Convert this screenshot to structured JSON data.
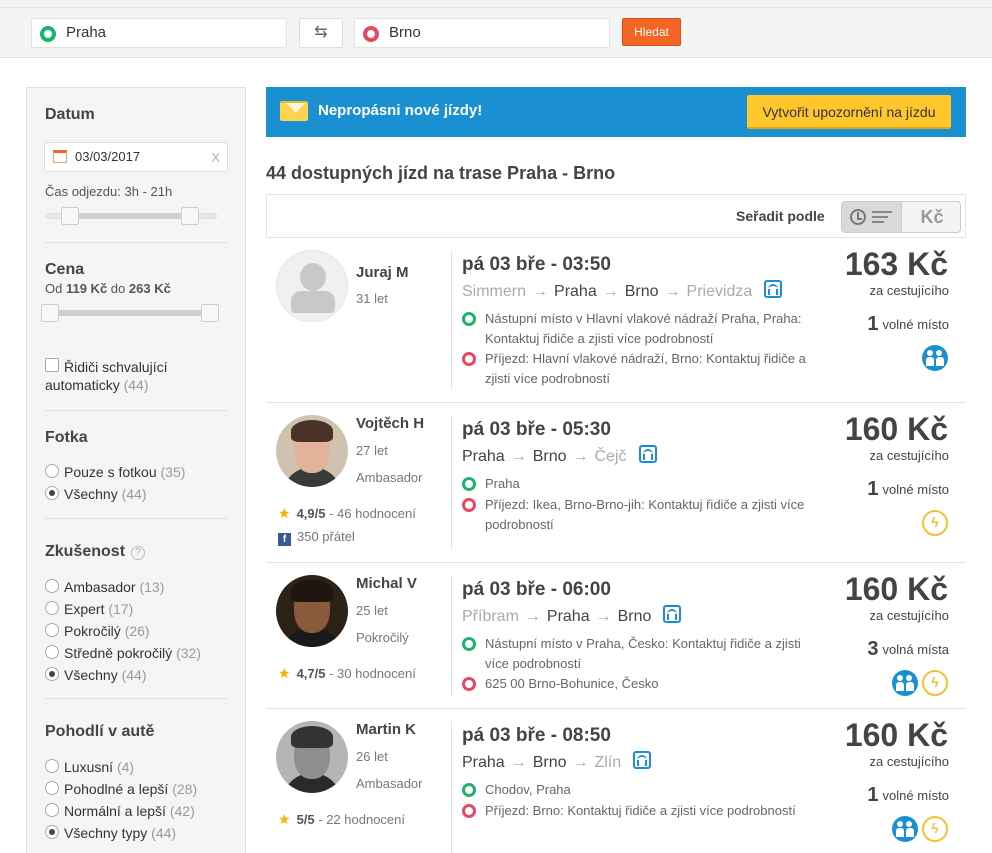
{
  "search": {
    "from": "Praha",
    "to": "Brno",
    "submit": "Hledat"
  },
  "sidebar": {
    "date_heading": "Datum",
    "date_value": "03/03/2017",
    "date_clear": "x",
    "departure_time": "Čas odjezdu: 3h - 21h",
    "departure_range": {
      "from_hour": 3,
      "to_hour": 21
    },
    "price_heading": "Cena",
    "price_from_label": "Od",
    "price_from": "119 Kč",
    "price_to_label": "do",
    "price_to": "263 Kč",
    "auto_approve_label": "Řidiči schvalující automaticky",
    "auto_approve_count": "(44)",
    "photo_heading": "Fotka",
    "photo_options": [
      {
        "label": "Pouze s fotkou",
        "count": "(35)",
        "selected": false
      },
      {
        "label": "Všechny",
        "count": "(44)",
        "selected": true
      }
    ],
    "experience_heading": "Zkušenost",
    "experience_help": "?",
    "experience_options": [
      {
        "label": "Ambasador",
        "count": "(13)",
        "selected": false
      },
      {
        "label": "Expert",
        "count": "(17)",
        "selected": false
      },
      {
        "label": "Pokročilý",
        "count": "(26)",
        "selected": false
      },
      {
        "label": "Středně pokročilý",
        "count": "(32)",
        "selected": false
      },
      {
        "label": "Všechny",
        "count": "(44)",
        "selected": true
      }
    ],
    "comfort_heading": "Pohodlí v autě",
    "comfort_options": [
      {
        "label": "Luxusní",
        "count": "(4)",
        "selected": false
      },
      {
        "label": "Pohodlné a lepší",
        "count": "(28)",
        "selected": false
      },
      {
        "label": "Normální a lepší",
        "count": "(42)",
        "selected": false
      },
      {
        "label": "Všechny typy",
        "count": "(44)",
        "selected": true
      }
    ]
  },
  "banner": {
    "text": "Nepropásni nové jízdy!",
    "button": "Vytvořit upozornění na jízdu"
  },
  "results": {
    "title": "44 dostupných jízd na trase Praha - Brno",
    "sort_label": "Seřadit podle",
    "sort_price": "Kč"
  },
  "rides": [
    {
      "driver": "Juraj M",
      "age": "31 let",
      "level": "",
      "rating": "",
      "reviews": "",
      "friends": "",
      "time": "pá 03 bře - 03:50",
      "route": [
        "Simmern",
        "Praha",
        "Brno",
        "Prievidza"
      ],
      "pickup": "Nástupní místo v Hlavní vlakové nádraží Praha, Praha: Kontaktuj řidiče a zjisti více podrobností",
      "dropoff": "Příjezd: Hlavní vlakové nádraží, Brno: Kontaktuj řidiče a zjisti více podrobností",
      "price": "163 Kč",
      "per": "za cestujícího",
      "seats": "1",
      "seats_label": "volné místo"
    },
    {
      "driver": "Vojtěch H",
      "age": "27 let",
      "level": "Ambasador",
      "rating": "4,9/5",
      "reviews": "- 46 hodnocení",
      "friends": "350 přátel",
      "time": "pá 03 bře - 05:30",
      "route": [
        "Praha",
        "Brno",
        "Čejč"
      ],
      "pickup": "Praha",
      "dropoff": "Příjezd: Ikea, Brno-Brno-jih: Kontaktuj řidiče a zjisti více podrobností",
      "price": "160 Kč",
      "per": "za cestujícího",
      "seats": "1",
      "seats_label": "volné místo"
    },
    {
      "driver": "Michal V",
      "age": "25 let",
      "level": "Pokročilý",
      "rating": "4,7/5",
      "reviews": "- 30 hodnocení",
      "friends": "",
      "time": "pá 03 bře - 06:00",
      "route": [
        "Příbram",
        "Praha",
        "Brno"
      ],
      "pickup": "Nástupní místo v Praha, Česko: Kontaktuj řidiče a zjisti více podrobností",
      "dropoff": "625 00 Brno-Bohunice, Česko",
      "price": "160 Kč",
      "per": "za cestujícího",
      "seats": "3",
      "seats_label": "volná místa"
    },
    {
      "driver": "Martin K",
      "age": "26 let",
      "level": "Ambasador",
      "rating": "5/5",
      "reviews": "- 22 hodnocení",
      "friends": "",
      "time": "pá 03 bře - 08:50",
      "route": [
        "Praha",
        "Brno",
        "Zlín"
      ],
      "pickup": "Chodov, Praha",
      "dropoff": "Příjezd: Brno: Kontaktuj řidiče a zjisti více podrobností",
      "price": "160 Kč",
      "per": "za cestujícího",
      "seats": "1",
      "seats_label": "volné místo"
    }
  ],
  "icons": {
    "highway": "highway-icon",
    "passengers": "passengers-icon",
    "power": "power-outlet-icon"
  },
  "colors": {
    "accent": "#1a8fd1",
    "search_button": "#f26522",
    "alert_button": "#ffc72c",
    "pickup": "#1fb26a",
    "dropoff": "#e8475f"
  }
}
